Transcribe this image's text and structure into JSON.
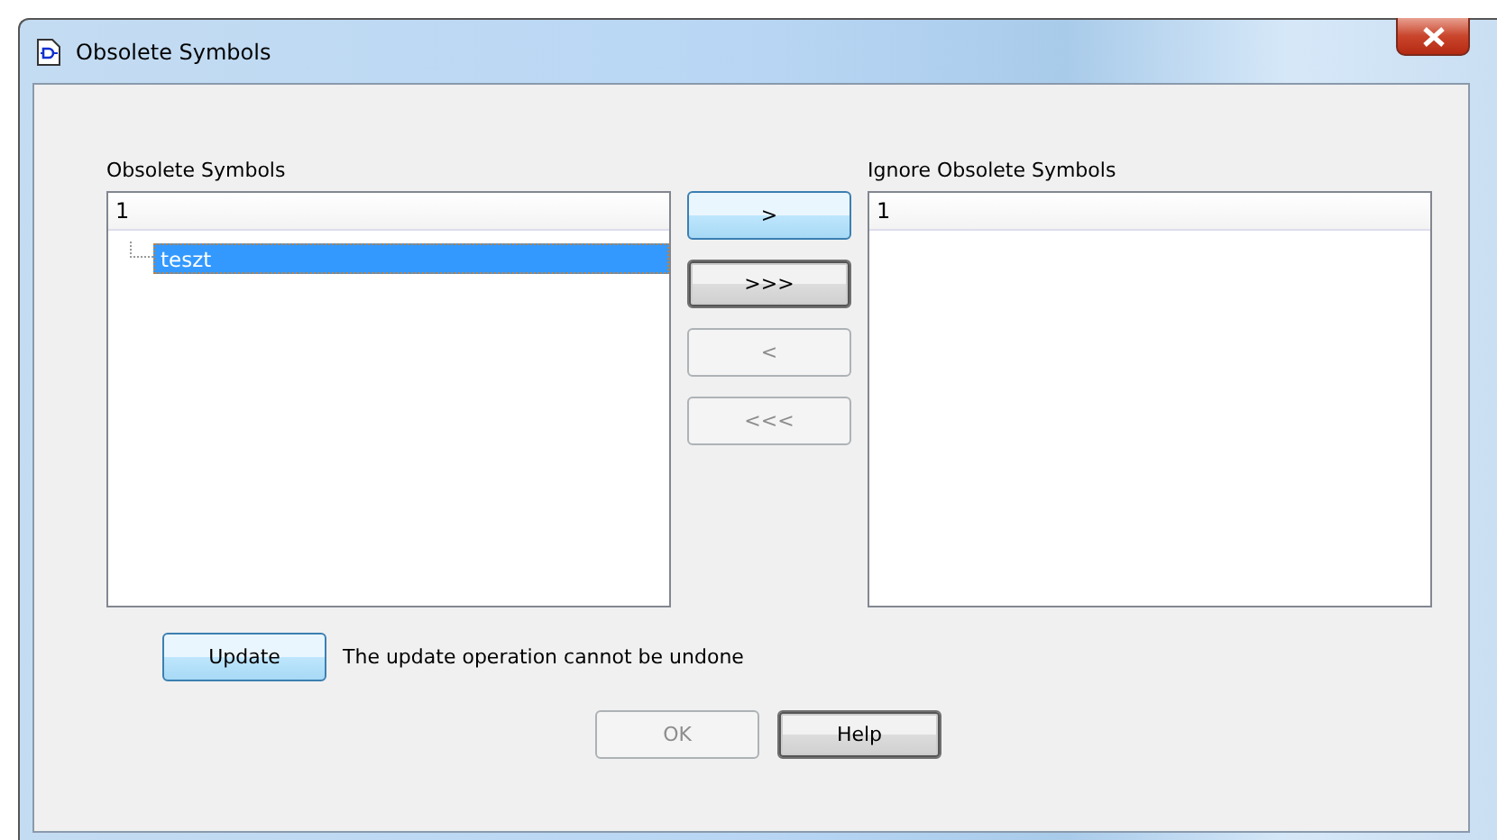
{
  "window": {
    "title": "Obsolete Symbols"
  },
  "obsolete_list": {
    "label": "Obsolete Symbols",
    "header": "1",
    "items": [
      {
        "label": "teszt",
        "selected": true
      }
    ]
  },
  "transfer_buttons": [
    {
      "label": ">",
      "highlighted": true,
      "focused": false,
      "disabled": false
    },
    {
      "label": ">>>",
      "highlighted": false,
      "focused": true,
      "disabled": false
    },
    {
      "label": "<",
      "highlighted": false,
      "focused": false,
      "disabled": true
    },
    {
      "label": "<<<",
      "highlighted": false,
      "focused": false,
      "disabled": true
    }
  ],
  "ignore_list": {
    "label": "Ignore Obsolete Symbols",
    "header": "1"
  },
  "update_button": {
    "label": "Update",
    "highlighted": true,
    "focused": false,
    "disabled": false
  },
  "update_note": "The update operation cannot be undone",
  "buttons": [
    {
      "label": "OK",
      "highlighted": false,
      "focused": false,
      "disabled": true
    },
    {
      "label": "Help",
      "highlighted": false,
      "focused": true,
      "disabled": false
    }
  ]
}
